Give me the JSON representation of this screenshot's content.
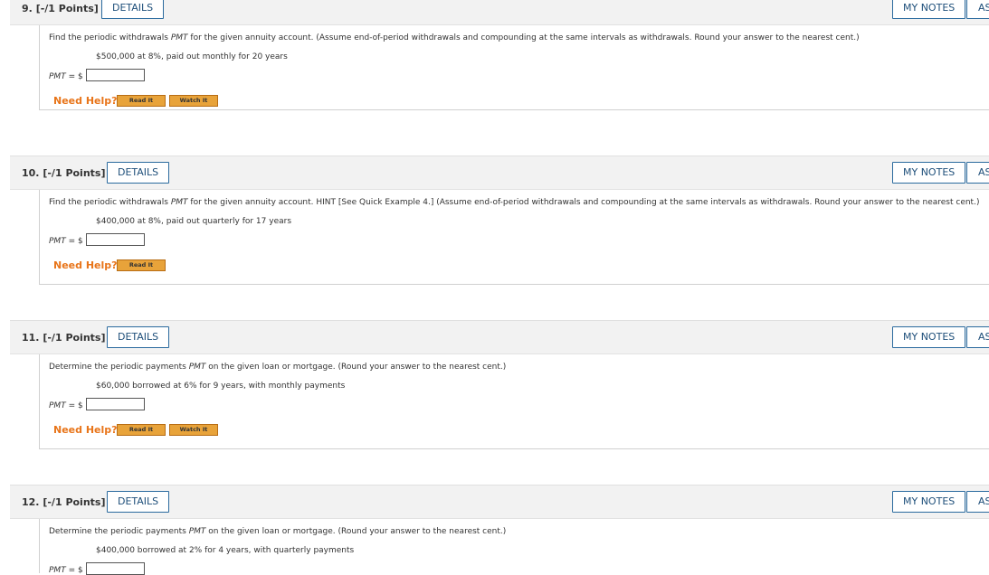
{
  "questions": [
    {
      "number": "9.",
      "points": "[-/1 Points]",
      "details_label": "DETAILS",
      "notes_label": "MY NOTES",
      "ask_label": "ASK YOUR TEACHER",
      "prompt_pre": "Find the periodic withdrawals ",
      "prompt_var": "PMT",
      "prompt_post": " for the given annuity account. (Assume end-of-period withdrawals and compounding at the same intervals as withdrawals. Round your answer to the nearest cent.)",
      "given": "$500,000 at 8%, paid out monthly for 20 years",
      "pmt_var": "PMT",
      "pmt_suffix": " = $",
      "need_help": "Need Help?",
      "read_it": "Read It",
      "watch_it": "Watch It"
    },
    {
      "number": "10.",
      "points": "[-/1 Points]",
      "details_label": "DETAILS",
      "notes_label": "MY NOTES",
      "ask_label": "ASK YOUR TEACHER",
      "prompt_pre": "Find the periodic withdrawals ",
      "prompt_var": "PMT",
      "prompt_post": " for the given annuity account. HINT [See Quick Example 4.] (Assume end-of-period withdrawals and compounding at the same intervals as withdrawals. Round your answer to the nearest cent.)",
      "given": "$400,000 at 8%, paid out quarterly for 17 years",
      "pmt_var": "PMT",
      "pmt_suffix": " = $",
      "need_help": "Need Help?",
      "read_it": "Read It"
    },
    {
      "number": "11.",
      "points": "[-/1 Points]",
      "details_label": "DETAILS",
      "notes_label": "MY NOTES",
      "ask_label": "ASK YOUR TEACHER",
      "prompt_pre": "Determine the periodic payments ",
      "prompt_var": "PMT",
      "prompt_post": " on the given loan or mortgage. (Round your answer to the nearest cent.)",
      "given": "$60,000 borrowed at 6% for 9 years, with monthly payments",
      "pmt_var": "PMT",
      "pmt_suffix": " = $",
      "need_help": "Need Help?",
      "read_it": "Read It",
      "watch_it": "Watch It"
    },
    {
      "number": "12.",
      "points": "[-/1 Points]",
      "details_label": "DETAILS",
      "notes_label": "MY NOTES",
      "ask_label": "ASK YOUR TEACHER",
      "prompt_pre": "Determine the periodic payments ",
      "prompt_var": "PMT",
      "prompt_post": " on the given loan or mortgage. (Round your answer to the nearest cent.)",
      "given": "$400,000 borrowed at 2% for 4 years, with quarterly payments",
      "pmt_var": "PMT",
      "pmt_suffix": " = $"
    }
  ]
}
